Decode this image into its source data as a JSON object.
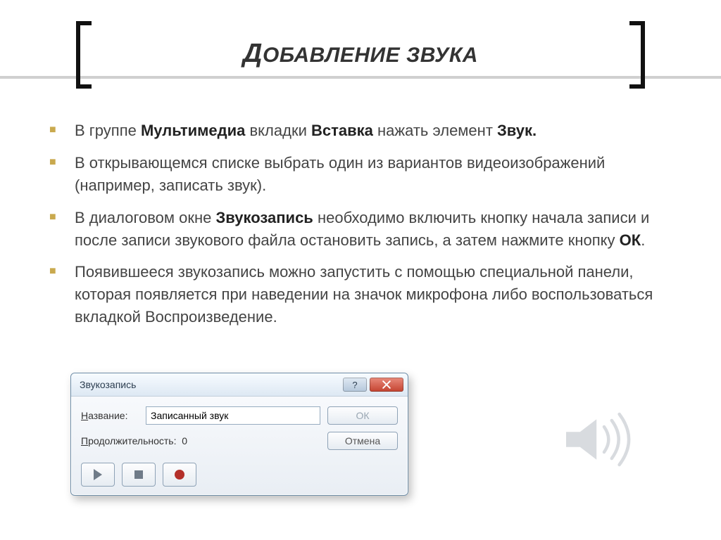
{
  "title_cap": "Д",
  "title_rest": "ОБАВЛЕНИЕ ЗВУКА",
  "bullets": [
    {
      "pre": "В группе ",
      "b1": "Мультимедиа",
      "mid": " вкладки ",
      "b2": "Вставка",
      "mid2": " нажать элемент ",
      "b3": "Звук.",
      "post": ""
    },
    {
      "pre": "В открывающемся списке выбрать один из вариантов видеоизображений (например, записать звук)."
    },
    {
      "pre": "В диалоговом окне ",
      "b1": "Звукозапись",
      "mid": " необходимо включить кнопку начала записи и после записи звукового файла остановить запись, а затем нажмите кнопку ",
      "b2": "ОК",
      "post": "."
    },
    {
      "pre": "Появившееся звукозапись можно запустить с помощью специальной панели, которая появляется при наведении на значок микрофона либо воспользоваться вкладкой Воспроизведение."
    }
  ],
  "dialog": {
    "title": "Звукозапись",
    "name_label_u": "Н",
    "name_label_rest": "азвание:",
    "name_value": "Записанный звук",
    "dur_label_u": "П",
    "dur_label_rest": "родолжительность:",
    "dur_value": "0",
    "ok": "ОК",
    "cancel": "Отмена",
    "help": "?"
  }
}
